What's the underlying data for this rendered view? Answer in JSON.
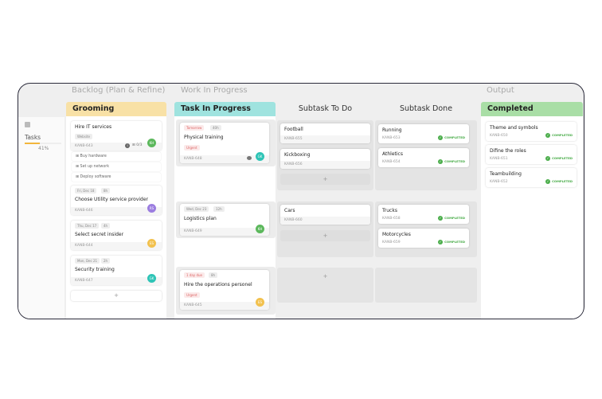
{
  "groups": {
    "backlog": "Backlog (Plan & Refine)",
    "wip": "Work In Progress",
    "output": "Output"
  },
  "sidebar": {
    "label": "Tasks",
    "percent": "41%",
    "progress": 41
  },
  "columns": {
    "grooming": "Grooming",
    "in_progress": "Task In Progress",
    "subtask_todo": "Subtask To Do",
    "subtask_done": "Subtask Done",
    "completed": "Completed"
  },
  "colors": {
    "grooming": "#f8e1a6",
    "in_progress": "#9fe3df",
    "completed": "#a9dea6",
    "completed_badge": "#4cae4c"
  },
  "add_label": "+",
  "completed_label": "COMPLETED",
  "grooming": [
    {
      "title": "Hire IT services",
      "tag": "Website",
      "key": "KANB-643",
      "subtasks": "0/3",
      "avatar": "KH",
      "avatar_color": "#5cb85c",
      "subitems": [
        "Buy hardware",
        "Set up network",
        "Deploy software"
      ]
    },
    {
      "date": "Fri, Dec 18",
      "est": "8h",
      "title": "Choose Utility service provider",
      "key": "KANB-646",
      "avatar": "RS",
      "avatar_color": "#9b7de0"
    },
    {
      "date": "Thu, Dec 17",
      "est": "4h",
      "title": "Select secret insider",
      "key": "KANB-644",
      "avatar": "ES",
      "avatar_color": "#f2c14e"
    },
    {
      "date": "Mon, Dec 21",
      "est": "2h",
      "title": "Security training",
      "key": "KANB-647",
      "avatar": "GK",
      "avatar_color": "#2ec4b6"
    }
  ],
  "in_progress": [
    {
      "date": "Tomorrow",
      "est": "40h",
      "title": "Physical training",
      "tag": "Urgent",
      "key": "KANB-648",
      "avatar": "GK",
      "avatar_color": "#2ec4b6"
    },
    {
      "date": "Wed, Dec 23",
      "est": "12h",
      "title": "Logistics plan",
      "key": "KANB-649",
      "avatar": "KH",
      "avatar_color": "#5cb85c"
    },
    {
      "date": "1 day due",
      "est": "8h",
      "title": "Hire the operations personel",
      "tag": "Urgent",
      "key": "KANB-645",
      "avatar": "ES",
      "avatar_color": "#f2c14e"
    }
  ],
  "todo": [
    {
      "title": "Football",
      "key": "KANB-655"
    },
    {
      "title": "Kickboxing",
      "key": "KANB-656"
    },
    {
      "title": "Cars",
      "key": "KANB-660"
    }
  ],
  "done": [
    {
      "title": "Running",
      "key": "KANB-653"
    },
    {
      "title": "Athletics",
      "key": "KANB-654"
    },
    {
      "title": "Trucks",
      "key": "KANB-658"
    },
    {
      "title": "Motorcycles",
      "key": "KANB-659"
    }
  ],
  "completed": [
    {
      "title": "Theme and symbols",
      "key": "KANB-650"
    },
    {
      "title": "Difine the roles",
      "key": "KANB-651"
    },
    {
      "title": "Teambuilding",
      "key": "KANB-652"
    }
  ]
}
